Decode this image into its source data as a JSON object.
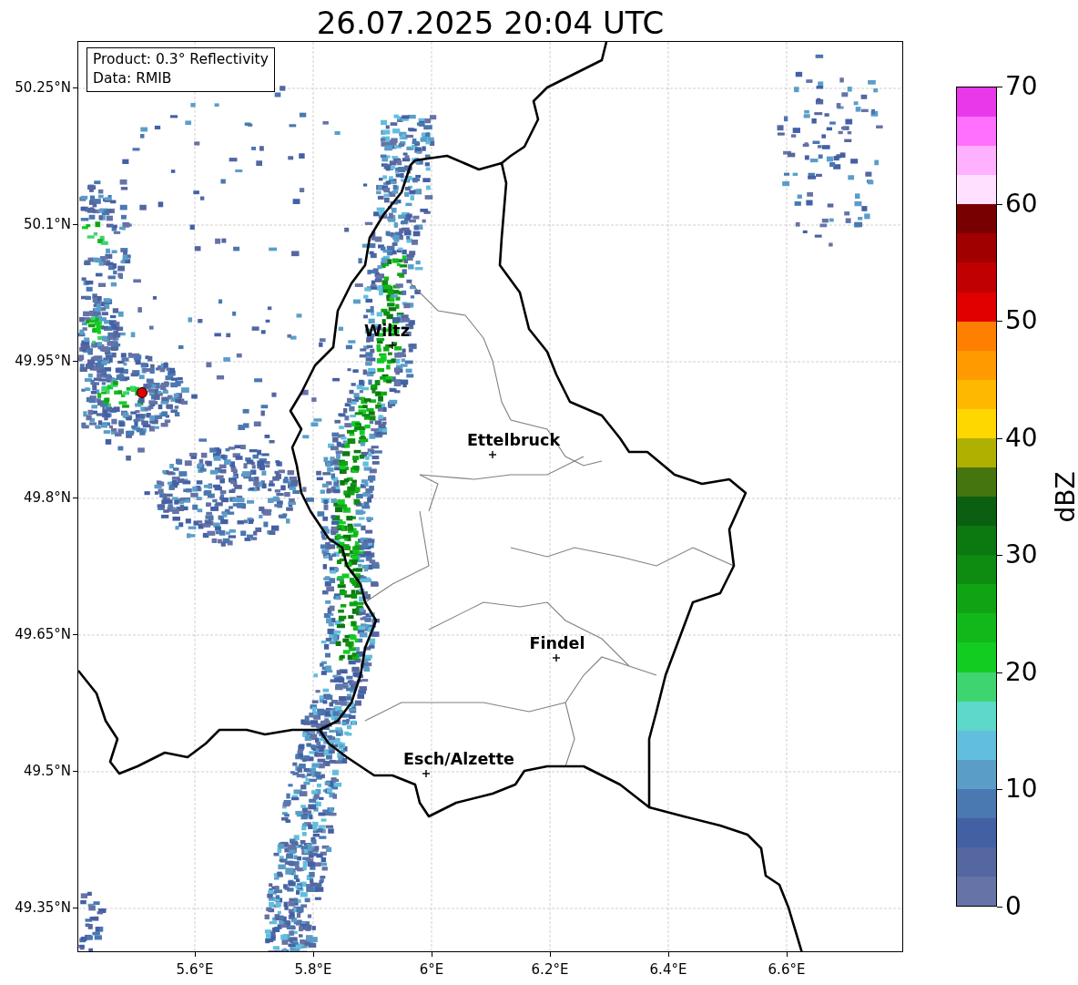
{
  "title": "26.07.2025 20:04 UTC",
  "map": {
    "info_box": [
      "Product: 0.3° Reflectivity",
      "Data: RMIB"
    ],
    "yticks": [
      "50.25°N",
      "50.1°N",
      "49.95°N",
      "49.8°N",
      "49.65°N",
      "49.5°N",
      "49.35°N"
    ],
    "xticks": [
      "5.6°E",
      "5.8°E",
      "6°E",
      "6.2°E",
      "6.4°E",
      "6.6°E"
    ],
    "cities": [
      {
        "name": "Wiltz"
      },
      {
        "name": "Ettelbruck"
      },
      {
        "name": "Findel"
      },
      {
        "name": "Esch/Alzette"
      }
    ]
  },
  "colorbar": {
    "label": "dBZ",
    "ticks": [
      "70",
      "60",
      "50",
      "40",
      "30",
      "20",
      "10",
      "0"
    ],
    "segments": [
      {
        "color": "#e838e8"
      },
      {
        "color": "#ff70ff"
      },
      {
        "color": "#ffb0ff"
      },
      {
        "color": "#ffe0ff"
      },
      {
        "color": "#780000"
      },
      {
        "color": "#a00000"
      },
      {
        "color": "#c00000"
      },
      {
        "color": "#e00000"
      },
      {
        "color": "#ff7f00"
      },
      {
        "color": "#ff9a00"
      },
      {
        "color": "#ffb800"
      },
      {
        "color": "#ffd700"
      },
      {
        "color": "#b0b000"
      },
      {
        "color": "#45750e"
      },
      {
        "color": "#0a6010"
      },
      {
        "color": "#0c7810"
      },
      {
        "color": "#0e8c12"
      },
      {
        "color": "#10a414"
      },
      {
        "color": "#12b81a"
      },
      {
        "color": "#12cc22"
      },
      {
        "color": "#3ed470"
      },
      {
        "color": "#5ed8c8"
      },
      {
        "color": "#62bedd"
      },
      {
        "color": "#5a9ec8"
      },
      {
        "color": "#4a78b0"
      },
      {
        "color": "#4460a4"
      },
      {
        "color": "#5567a0"
      },
      {
        "color": "#6673a6"
      }
    ]
  }
}
